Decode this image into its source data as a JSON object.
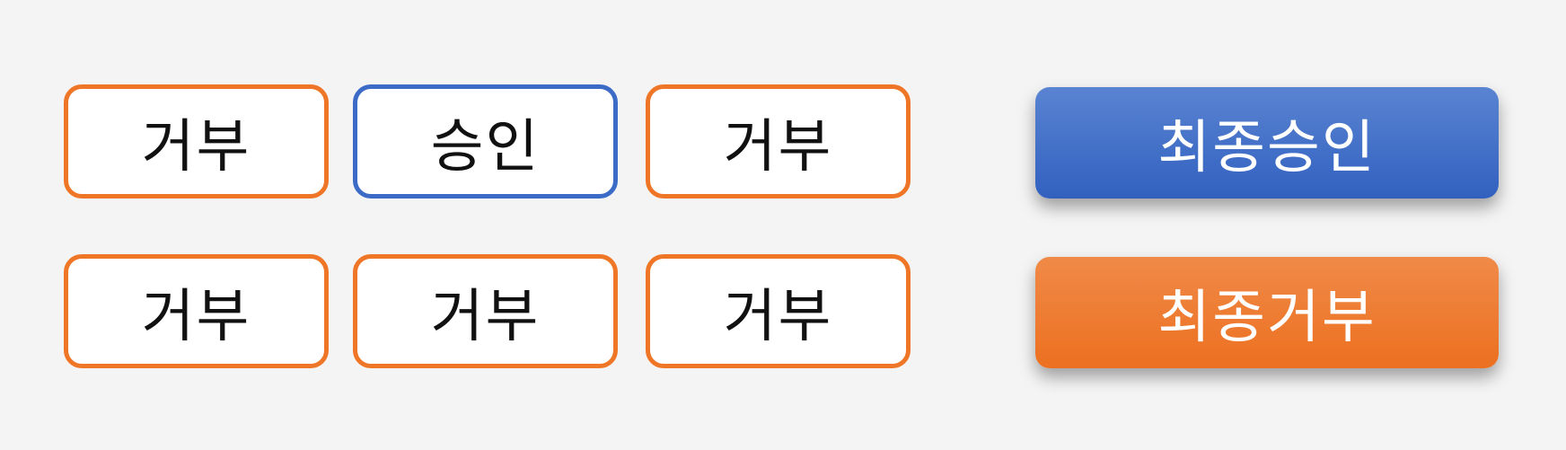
{
  "votes": {
    "row1": [
      "거부",
      "승인",
      "거부"
    ],
    "row2": [
      "거부",
      "거부",
      "거부"
    ]
  },
  "actions": {
    "final_approve_label": "최종승인",
    "final_reject_label": "최종거부"
  },
  "colors": {
    "background": "#f4f4f4",
    "reject_accent": "#ee7626",
    "approve_accent": "#3b6bc7"
  }
}
